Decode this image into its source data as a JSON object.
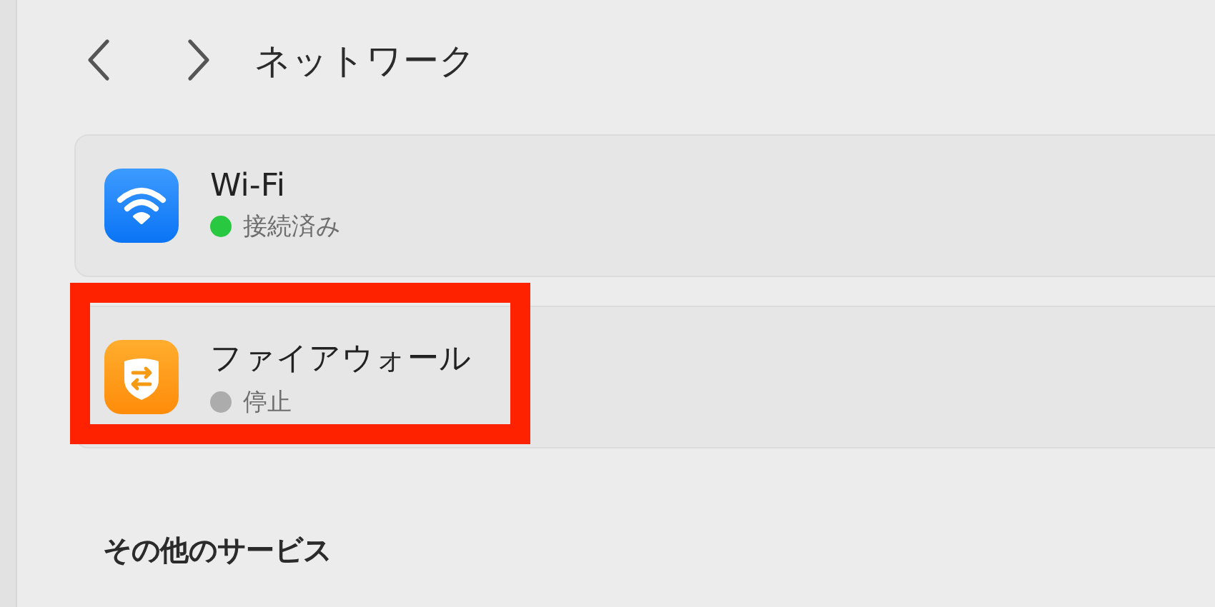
{
  "header": {
    "title": "ネットワーク"
  },
  "services": [
    {
      "kind": "wifi",
      "name": "Wi-Fi",
      "status": "接続済み",
      "color": "#28c840",
      "highlighted": false
    },
    {
      "kind": "firewall",
      "name": "ファイアウォール",
      "status": "停止",
      "color": "#acacac",
      "highlighted": true
    }
  ],
  "section_heading": "その他のサービス"
}
